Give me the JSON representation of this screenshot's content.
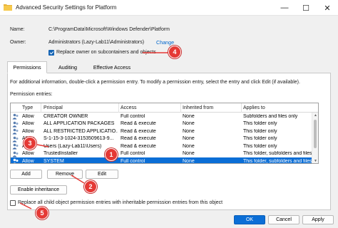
{
  "window": {
    "title": "Advanced Security Settings for Platform",
    "minimize_glyph": "—",
    "maximize_glyph": "☐",
    "close_glyph": "✕"
  },
  "name": {
    "label": "Name:",
    "value": "C:\\ProgramData\\Microsoft\\Windows Defender\\Platform"
  },
  "owner": {
    "label": "Owner:",
    "value": "Administrators (Lazy-Lab11\\Administrators)",
    "change_link": "Change"
  },
  "replace_owner": {
    "label": "Replace owner on subcontainers and objects",
    "checked": true
  },
  "tabs": [
    {
      "label": "Permissions",
      "active": true
    },
    {
      "label": "Auditing",
      "active": false
    },
    {
      "label": "Effective Access",
      "active": false
    }
  ],
  "info_text": "For additional information, double-click a permission entry. To modify a permission entry, select the entry and click Edit (if available).",
  "entries_label": "Permission entries:",
  "columns": [
    "Type",
    "Principal",
    "Access",
    "Inherited from",
    "Applies to"
  ],
  "entries": [
    {
      "type": "Allow",
      "principal": "CREATOR OWNER",
      "access": "Full control",
      "inherited": "None",
      "applies": "Subfolders and files only",
      "selected": false
    },
    {
      "type": "Allow",
      "principal": "ALL APPLICATION PACKAGES",
      "access": "Read & execute",
      "inherited": "None",
      "applies": "This folder only",
      "selected": false
    },
    {
      "type": "Allow",
      "principal": "ALL RESTRICTED APPLICATIO...",
      "access": "Read & execute",
      "inherited": "None",
      "applies": "This folder only",
      "selected": false
    },
    {
      "type": "Allow",
      "principal": "S-1-15-3-1024-3153509613-9...",
      "access": "Read & execute",
      "inherited": "None",
      "applies": "This folder only",
      "selected": false
    },
    {
      "type": "Allow",
      "principal": "Users (Lazy-Lab11\\Users)",
      "access": "Read & execute",
      "inherited": "None",
      "applies": "This folder only",
      "selected": false
    },
    {
      "type": "Allow",
      "principal": "TrustedInstaller",
      "access": "Full control",
      "inherited": "None",
      "applies": "This folder, subfolders and files",
      "selected": false
    },
    {
      "type": "Allow",
      "principal": "SYSTEM",
      "access": "Full control",
      "inherited": "None",
      "applies": "This folder, subfolders and files",
      "selected": true
    }
  ],
  "buttons": {
    "add": "Add",
    "remove": "Remove",
    "edit": "Edit",
    "enable_inheritance": "Enable inheritance",
    "ok": "OK",
    "cancel": "Cancel",
    "apply": "Apply"
  },
  "replace_child": {
    "label": "Replace all child object permission entries with inheritable permission entries from this object",
    "checked": false
  },
  "callouts": [
    "1",
    "2",
    "3",
    "4",
    "5"
  ],
  "colors": {
    "selection": "#0b6ed6",
    "callout": "#e53935",
    "link": "#0066cc"
  }
}
